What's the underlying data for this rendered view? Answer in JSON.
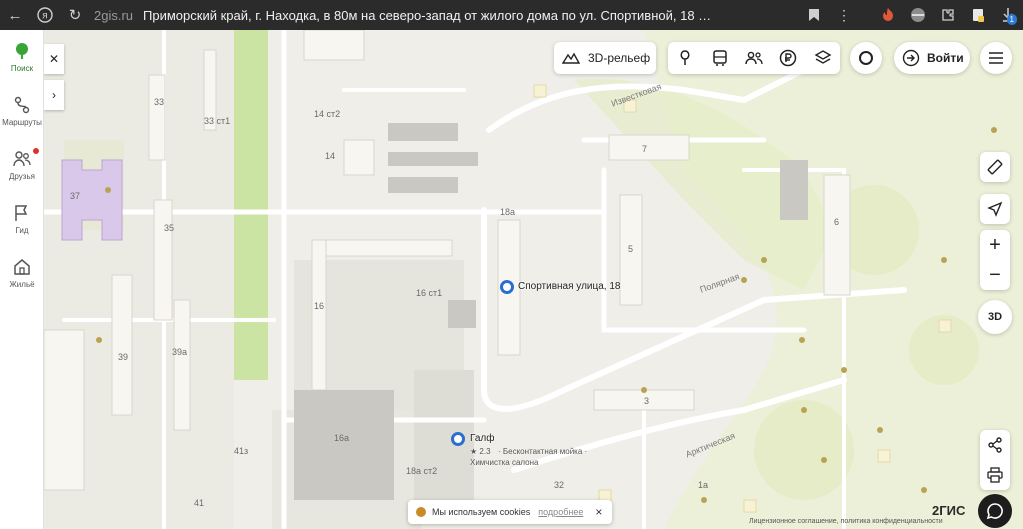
{
  "browser": {
    "domain": "2gis.ru",
    "tab_title": "Приморский край, г. Находка, в 80м на северо-запад от жилого дома по ул. Спортивной, 18 — 2…",
    "ext_badge": "1"
  },
  "sidebar": {
    "items": [
      {
        "label": "Поиск",
        "icon": "tree-icon",
        "active": true
      },
      {
        "label": "Маршруты",
        "icon": "route-icon"
      },
      {
        "label": "Друзья",
        "icon": "friends-icon",
        "notification": true
      },
      {
        "label": "Гид",
        "icon": "flag-icon"
      },
      {
        "label": "Жильё",
        "icon": "house-icon"
      }
    ]
  },
  "toolbar": {
    "relief_label": "3D-рельеф",
    "login_label": "Войти"
  },
  "map": {
    "house_numbers": [
      "33",
      "33 ст1",
      "14 ст2",
      "14",
      "37",
      "35",
      "18а",
      "7",
      "5",
      "6",
      "16 ст1",
      "16",
      "39",
      "39а",
      "3",
      "16а",
      "41",
      "41з",
      "18а ст2",
      "32",
      "1а"
    ],
    "streets": [
      "Известковая",
      "Полярная",
      "Арктическая"
    ],
    "markers": [
      {
        "title": "Спортивная улица, 18"
      },
      {
        "title": "Галф",
        "rating": "★ 2.3",
        "details": "· Бесконтактная мойка ·",
        "details2": "Химчистка салона"
      }
    ]
  },
  "controls": {
    "zoom_in": "+",
    "zoom_out": "−",
    "view_3d": "3D"
  },
  "cookies": {
    "text": "Мы используем cookies",
    "more": "подробнее",
    "close": "×"
  },
  "brand": "2ГИС",
  "license": "Лицензионное соглашение, политика конфиденциальности"
}
